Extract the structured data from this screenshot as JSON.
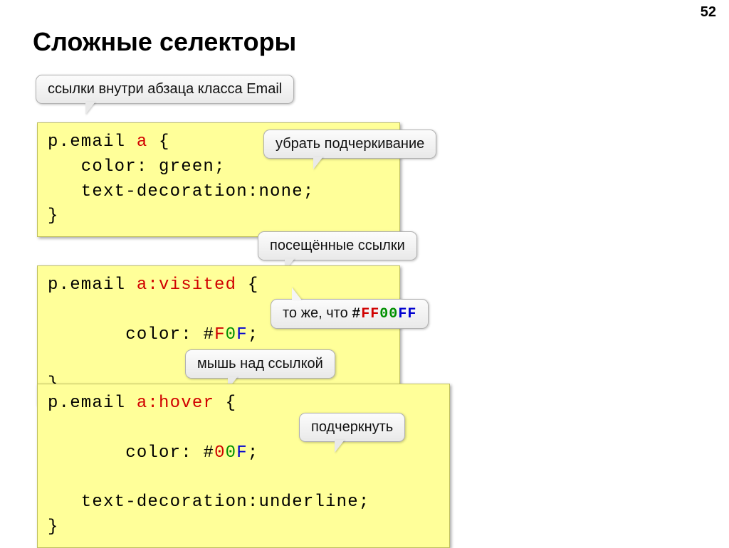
{
  "page_number": "52",
  "title": "Сложные селекторы",
  "callouts": {
    "top": "ссылки внутри абзаца класса Email",
    "remove_underline": "убрать подчеркивание",
    "visited": "посещённые ссылки",
    "same_as_prefix": "то же, что ",
    "same_as_hash": "#",
    "same_as_r": "FF",
    "same_as_g": "00",
    "same_as_b": "FF",
    "mouse_over": "мышь над ссылкой",
    "underline": "подчеркнуть"
  },
  "code1": {
    "l1a": "p.email ",
    "l1b": "a",
    "l1c": " {",
    "l2": "   color: green;",
    "l3": "   text-decoration:none;",
    "l4": "}"
  },
  "code2": {
    "l1a": "p.email ",
    "l1b": "a:visited",
    "l1c": " {",
    "l2a": "   color: ",
    "l2b": "#",
    "l2r": "F",
    "l2g": "0",
    "l2bb": "F",
    "l2c": ";",
    "l3": "}"
  },
  "code3": {
    "l1a": "p.email ",
    "l1b": "a:hover",
    "l1c": " {",
    "l2a": "   color: ",
    "l2b": "#",
    "l2r": "0",
    "l2g": "0",
    "l2bb": "F",
    "l2c": ";",
    "l3": "   text-decoration:underline;",
    "l4": "}"
  }
}
